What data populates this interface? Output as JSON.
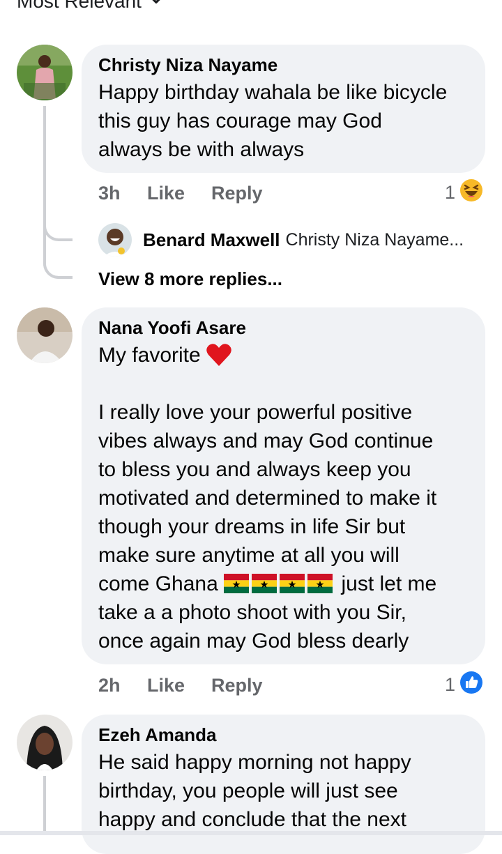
{
  "sort": {
    "label": "Most Relevant"
  },
  "comments": [
    {
      "author": "Christy Niza Nayame",
      "text": "Happy birthday wahala be like bicycle\nthis guy has courage may God\nalways be with always",
      "time": "3h",
      "like_label": "Like",
      "reply_label": "Reply",
      "reaction_count": "1",
      "reaction_icon": "haha-reaction-icon",
      "reply_preview": {
        "author": "Benard Maxwell",
        "text": "Christy Niza Nayame..."
      },
      "view_more": "View 8 more replies..."
    },
    {
      "author": "Nana Yoofi Asare",
      "text_line1": "My favorite",
      "text_body": "I really love your powerful positive\nvibes always and may God continue\nto bless you and always keep you\nmotivated and determined to make it\nthough your dreams in life Sir but\nmake sure anytime at all you will",
      "text_ghana_prefix": "come Ghana",
      "text_ghana_suffix": "just let me",
      "text_tail": "take a a photo shoot with you Sir,\nonce again may God bless dearly",
      "time": "2h",
      "like_label": "Like",
      "reply_label": "Reply",
      "reaction_count": "1",
      "reaction_icon": "like-reaction-icon"
    },
    {
      "author": "Ezeh Amanda",
      "text": "He said happy morning not happy\nbirthday, you people will just see\nhappy and conclude that the next"
    }
  ],
  "colors": {
    "bubble": "#f0f2f5",
    "meta_text": "#65676b",
    "like_blue": "#1877f2",
    "thread_line": "#ced0d4"
  }
}
